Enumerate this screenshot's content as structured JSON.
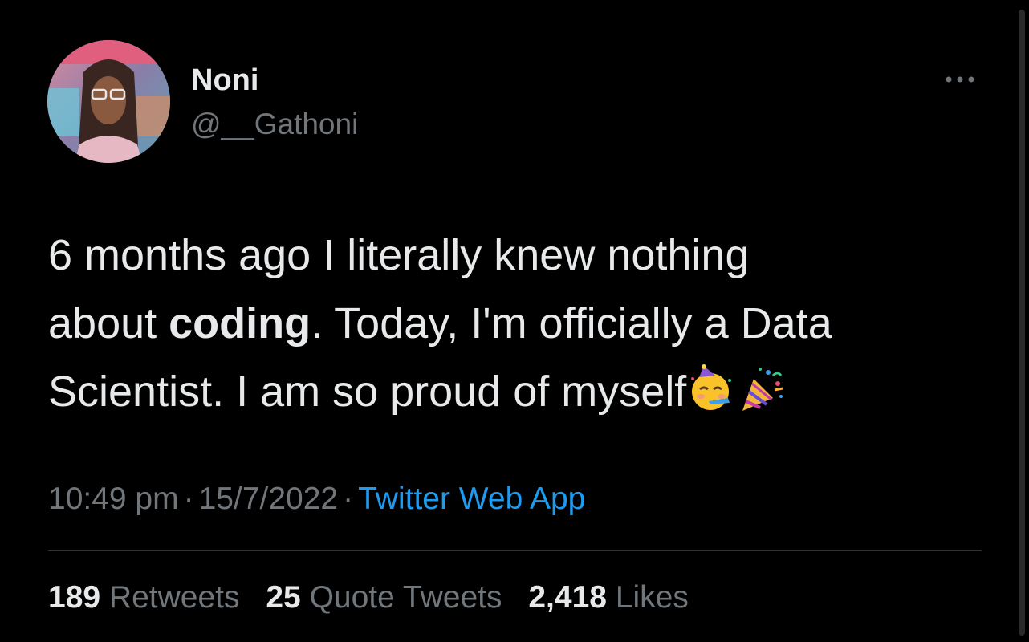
{
  "author": {
    "display_name": "Noni",
    "handle": "@__Gathoni"
  },
  "tweet": {
    "lines": [
      {
        "before": "6 months ago I literally knew nothing",
        "bold": "",
        "after": ""
      },
      {
        "before": "about ",
        "bold": "coding",
        "after": ". Today, I'm officially a Data"
      },
      {
        "before": "Scientist. I am so proud of myself",
        "bold": "",
        "after": ""
      }
    ],
    "emojis": [
      "partying-face-emoji",
      "party-popper-emoji"
    ]
  },
  "meta": {
    "time": "10:49 pm",
    "separator": "·",
    "date": "15/7/2022",
    "source": "Twitter Web App"
  },
  "stats": {
    "retweets_count": "189",
    "retweets_label": "Retweets",
    "quotes_count": "25",
    "quotes_label": "Quote Tweets",
    "likes_count": "2,418",
    "likes_label": "Likes"
  },
  "colors": {
    "background": "#000000",
    "text": "#e7e9ea",
    "secondary": "#71767b",
    "link": "#1d9bf0",
    "divider": "#2f3336"
  }
}
